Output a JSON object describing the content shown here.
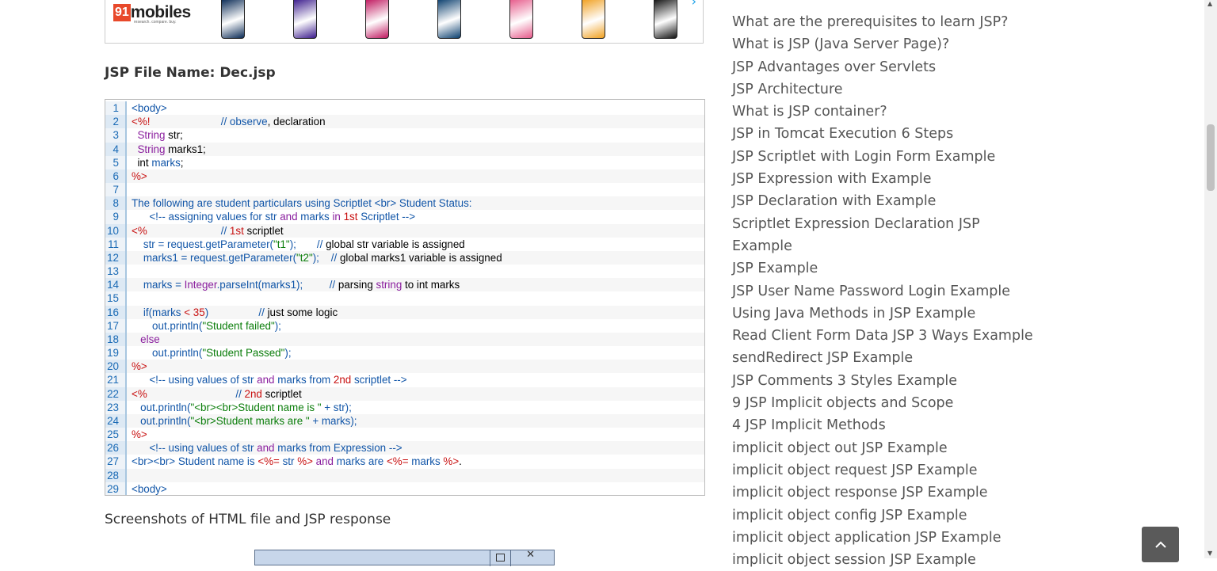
{
  "ad": {
    "logo_number": "91",
    "logo_brand": "mobiles",
    "tagline": "research. compare. buy.",
    "phone_colors": [
      "#0a2a55",
      "#3b1b8c",
      "#c0185f",
      "#0b3f6e",
      "#e65a8a",
      "#f0a020",
      "#111111"
    ]
  },
  "heading": "JSP File Name: Dec.jsp",
  "code_lines": [
    {
      "n": "1",
      "parts": [
        {
          "c": "t-blue",
          "t": "<body>"
        }
      ]
    },
    {
      "n": "2",
      "parts": [
        {
          "c": "t-red",
          "t": "<%!"
        },
        {
          "c": "t-black",
          "t": "                        "
        },
        {
          "c": "t-blue",
          "t": "// observe"
        },
        {
          "c": "t-black",
          "t": ", declaration"
        }
      ]
    },
    {
      "n": "3",
      "parts": [
        {
          "c": "t-black",
          "t": "  "
        },
        {
          "c": "t-purple",
          "t": "String"
        },
        {
          "c": "t-black",
          "t": " str;"
        }
      ]
    },
    {
      "n": "4",
      "parts": [
        {
          "c": "t-black",
          "t": "  "
        },
        {
          "c": "t-purple",
          "t": "String"
        },
        {
          "c": "t-black",
          "t": " marks1;"
        }
      ]
    },
    {
      "n": "5",
      "parts": [
        {
          "c": "t-black",
          "t": "  int "
        },
        {
          "c": "t-blue",
          "t": "marks"
        },
        {
          "c": "t-black",
          "t": ";"
        }
      ]
    },
    {
      "n": "6",
      "parts": [
        {
          "c": "t-red",
          "t": "%>"
        }
      ]
    },
    {
      "n": "7",
      "parts": []
    },
    {
      "n": "8",
      "parts": [
        {
          "c": "t-blue",
          "t": "The following are student particulars using Scriptlet <br> Student Status:"
        }
      ]
    },
    {
      "n": "9",
      "parts": [
        {
          "c": "t-black",
          "t": "      "
        },
        {
          "c": "t-blue",
          "t": "<!-- assigning values for str "
        },
        {
          "c": "t-purple",
          "t": "and"
        },
        {
          "c": "t-blue",
          "t": " marks "
        },
        {
          "c": "t-purple",
          "t": "in"
        },
        {
          "c": "t-blue",
          "t": " "
        },
        {
          "c": "t-red",
          "t": "1st"
        },
        {
          "c": "t-blue",
          "t": " Scriptlet -->"
        }
      ]
    },
    {
      "n": "10",
      "parts": [
        {
          "c": "t-red",
          "t": "<%"
        },
        {
          "c": "t-black",
          "t": "                         "
        },
        {
          "c": "t-blue",
          "t": "// "
        },
        {
          "c": "t-red",
          "t": "1st"
        },
        {
          "c": "t-black",
          "t": " scriptlet"
        }
      ]
    },
    {
      "n": "11",
      "parts": [
        {
          "c": "t-black",
          "t": "    "
        },
        {
          "c": "t-blue",
          "t": "str = request.getParameter("
        },
        {
          "c": "t-green",
          "t": "\"t1\""
        },
        {
          "c": "t-blue",
          "t": ");"
        },
        {
          "c": "t-black",
          "t": "       "
        },
        {
          "c": "t-blue",
          "t": "// "
        },
        {
          "c": "t-black",
          "t": "global str variable is assigned"
        }
      ]
    },
    {
      "n": "12",
      "parts": [
        {
          "c": "t-black",
          "t": "    "
        },
        {
          "c": "t-blue",
          "t": "marks1 = request.getParameter("
        },
        {
          "c": "t-green",
          "t": "\"t2\""
        },
        {
          "c": "t-blue",
          "t": ");"
        },
        {
          "c": "t-black",
          "t": "    "
        },
        {
          "c": "t-blue",
          "t": "// "
        },
        {
          "c": "t-black",
          "t": "global marks1 variable is assigned"
        }
      ]
    },
    {
      "n": "13",
      "parts": []
    },
    {
      "n": "14",
      "parts": [
        {
          "c": "t-black",
          "t": "    "
        },
        {
          "c": "t-blue",
          "t": "marks = "
        },
        {
          "c": "t-purple",
          "t": "Integer"
        },
        {
          "c": "t-blue",
          "t": ".parseInt(marks1);"
        },
        {
          "c": "t-black",
          "t": "         "
        },
        {
          "c": "t-blue",
          "t": "// "
        },
        {
          "c": "t-black",
          "t": "parsing "
        },
        {
          "c": "t-purple",
          "t": "string"
        },
        {
          "c": "t-black",
          "t": " to int marks"
        }
      ]
    },
    {
      "n": "15",
      "parts": []
    },
    {
      "n": "16",
      "parts": [
        {
          "c": "t-black",
          "t": "    "
        },
        {
          "c": "t-blue",
          "t": "if(marks "
        },
        {
          "c": "t-red",
          "t": "<"
        },
        {
          "c": "t-blue",
          "t": " "
        },
        {
          "c": "t-red",
          "t": "35"
        },
        {
          "c": "t-blue",
          "t": ")"
        },
        {
          "c": "t-black",
          "t": "                 "
        },
        {
          "c": "t-blue",
          "t": "// "
        },
        {
          "c": "t-black",
          "t": "just some logic"
        }
      ]
    },
    {
      "n": "17",
      "parts": [
        {
          "c": "t-black",
          "t": "       "
        },
        {
          "c": "t-blue",
          "t": "out.println("
        },
        {
          "c": "t-green",
          "t": "\"Student failed\""
        },
        {
          "c": "t-blue",
          "t": ");"
        }
      ]
    },
    {
      "n": "18",
      "parts": [
        {
          "c": "t-black",
          "t": "   "
        },
        {
          "c": "t-purple",
          "t": "else"
        }
      ]
    },
    {
      "n": "19",
      "parts": [
        {
          "c": "t-black",
          "t": "       "
        },
        {
          "c": "t-blue",
          "t": "out.println("
        },
        {
          "c": "t-green",
          "t": "\"Student Passed\""
        },
        {
          "c": "t-blue",
          "t": ");"
        }
      ]
    },
    {
      "n": "20",
      "parts": [
        {
          "c": "t-red",
          "t": "%>"
        }
      ]
    },
    {
      "n": "21",
      "parts": [
        {
          "c": "t-black",
          "t": "      "
        },
        {
          "c": "t-blue",
          "t": "<!-- using values of str "
        },
        {
          "c": "t-purple",
          "t": "and"
        },
        {
          "c": "t-blue",
          "t": " marks from "
        },
        {
          "c": "t-red",
          "t": "2nd"
        },
        {
          "c": "t-blue",
          "t": " scriptlet -->"
        }
      ]
    },
    {
      "n": "22",
      "parts": [
        {
          "c": "t-red",
          "t": "<%"
        },
        {
          "c": "t-black",
          "t": "                              "
        },
        {
          "c": "t-blue",
          "t": "// "
        },
        {
          "c": "t-red",
          "t": "2nd"
        },
        {
          "c": "t-black",
          "t": " scriptlet"
        }
      ]
    },
    {
      "n": "23",
      "parts": [
        {
          "c": "t-black",
          "t": "   "
        },
        {
          "c": "t-blue",
          "t": "out.println("
        },
        {
          "c": "t-green",
          "t": "\"<br><br>Student name is \""
        },
        {
          "c": "t-blue",
          "t": " + str);"
        }
      ]
    },
    {
      "n": "24",
      "parts": [
        {
          "c": "t-black",
          "t": "   "
        },
        {
          "c": "t-blue",
          "t": "out.println("
        },
        {
          "c": "t-green",
          "t": "\"<br>Student marks are \""
        },
        {
          "c": "t-blue",
          "t": " + marks);"
        }
      ]
    },
    {
      "n": "25",
      "parts": [
        {
          "c": "t-red",
          "t": "%>"
        }
      ]
    },
    {
      "n": "26",
      "parts": [
        {
          "c": "t-black",
          "t": "      "
        },
        {
          "c": "t-blue",
          "t": "<!-- using values of str "
        },
        {
          "c": "t-purple",
          "t": "and"
        },
        {
          "c": "t-blue",
          "t": " marks from Expression -->"
        }
      ]
    },
    {
      "n": "27",
      "parts": [
        {
          "c": "t-blue",
          "t": "<br><br> Student name is "
        },
        {
          "c": "t-red",
          "t": "<%="
        },
        {
          "c": "t-blue",
          "t": " str "
        },
        {
          "c": "t-red",
          "t": "%>"
        },
        {
          "c": "t-blue",
          "t": " "
        },
        {
          "c": "t-purple",
          "t": "and"
        },
        {
          "c": "t-blue",
          "t": " marks are "
        },
        {
          "c": "t-red",
          "t": "<%="
        },
        {
          "c": "t-blue",
          "t": " marks "
        },
        {
          "c": "t-red",
          "t": "%>"
        },
        {
          "c": "t-black",
          "t": "."
        }
      ]
    },
    {
      "n": "28",
      "parts": []
    },
    {
      "n": "29",
      "parts": [
        {
          "c": "t-blue",
          "t": "<body>"
        }
      ]
    }
  ],
  "screenshots_label": "Screenshots of HTML file and JSP response",
  "window_close_glyph": "✕",
  "sidebar_links": [
    "What are the prerequisites to learn JSP?",
    "What is JSP (Java Server Page)?",
    "JSP Advantages over Servlets",
    "JSP Architecture",
    "What is JSP container?",
    "JSP in Tomcat Execution 6 Steps",
    "JSP Scriptlet with Login Form Example",
    "JSP Expression with Example",
    "JSP Declaration with Example",
    "Scriptlet Expression Declaration JSP",
    "Example",
    "JSP Example",
    "JSP User Name Password Login Example",
    "Using Java Methods in JSP Example",
    "Read Client Form Data JSP 3 Ways Example",
    "sendRedirect JSP Example",
    "JSP Comments 3 Styles Example",
    "9 JSP Implicit objects and Scope",
    "4 JSP Implicit Methods",
    "implicit object out JSP Example",
    "implicit object request JSP Example",
    "implicit object response JSP Example",
    "implicit object config JSP Example",
    "implicit object application JSP Example",
    "implicit object session JSP Example"
  ],
  "back_to_top_icon": "chevron-up",
  "scroll_up_glyph": "▲",
  "scroll_down_glyph": "▼"
}
